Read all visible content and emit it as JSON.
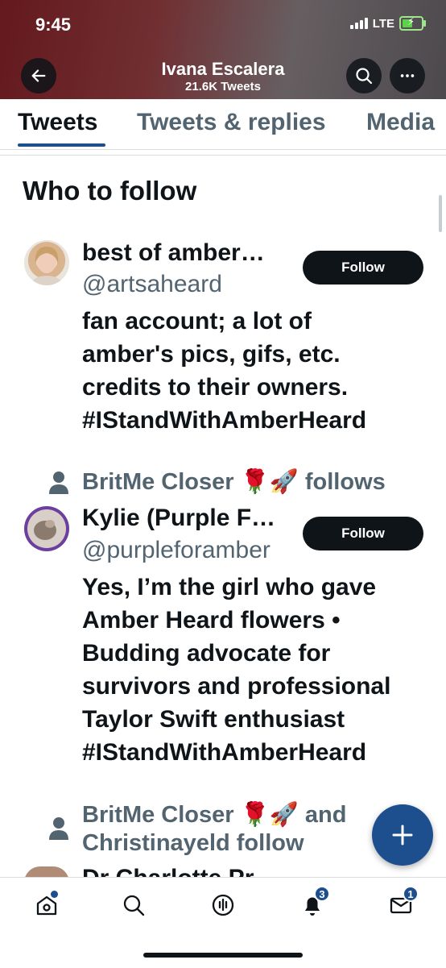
{
  "status_bar": {
    "time": "9:45",
    "network": "LTE"
  },
  "header": {
    "title": "Ivana Escalera",
    "subtitle": "21.6K Tweets",
    "icons": [
      "back-arrow-icon",
      "search-icon",
      "more-icon"
    ]
  },
  "tabs": [
    {
      "label": "Tweets",
      "active": true
    },
    {
      "label": "Tweets & replies",
      "active": false
    },
    {
      "label": "Media",
      "active": false
    }
  ],
  "section": {
    "title": "Who to follow"
  },
  "suggestions": [
    {
      "name": "best of amber…",
      "handle": "@artsaheard",
      "button": "Follow",
      "bio": "fan account; a lot of\namber's pics, gifs, etc.\ncredits to their owners.\n#IStandWithAmberHeard"
    },
    {
      "social_context": "BritMe Closer 🌹🚀 follows",
      "name": "Kylie (Purple F…",
      "handle": "@purpleforamber",
      "button": "Follow",
      "bio": "Yes, I’m the girl who gave\nAmber Heard flowers •\nBudding advocate for\nsurvivors and professional\nTaylor Swift enthusiast\n#IStandWithAmberHeard"
    },
    {
      "social_context_line1": "BritMe Closer 🌹🚀 and",
      "social_context_line2": "Christinayeld follow",
      "name_partial": "Dr Charlotte Pr"
    }
  ],
  "bottom_nav": {
    "items": [
      {
        "icon": "home-icon"
      },
      {
        "icon": "search-icon"
      },
      {
        "icon": "spaces-icon"
      },
      {
        "icon": "notifications-icon",
        "badge": "3"
      },
      {
        "icon": "messages-icon",
        "badge": "1"
      }
    ]
  },
  "colors": {
    "accent": "#1d4f8f",
    "text": "#0f1419",
    "secondary": "#536471"
  }
}
